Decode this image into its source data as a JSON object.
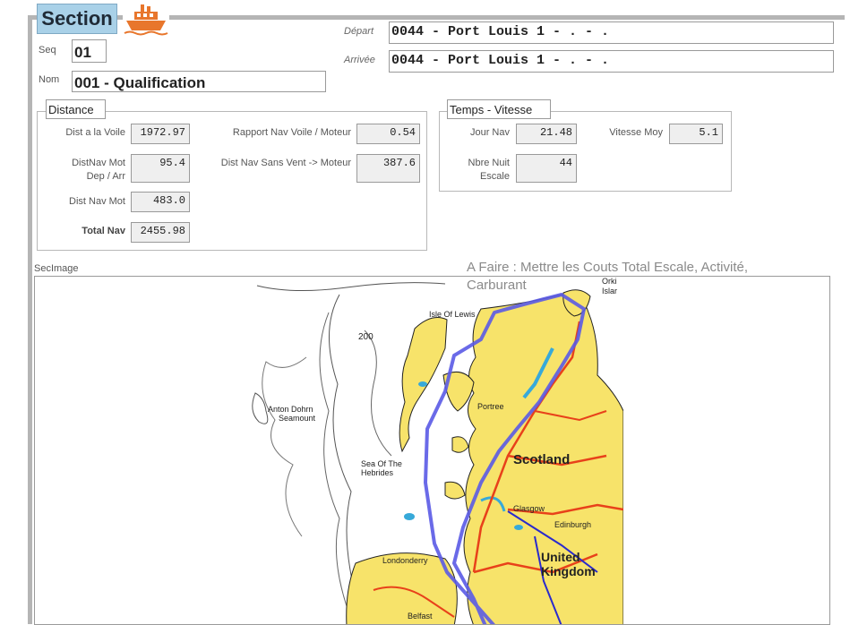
{
  "header": {
    "section_label": "Section",
    "ship_icon": "ship-icon"
  },
  "fields": {
    "seq_label": "Seq",
    "seq_value": "01",
    "nom_label": "Nom",
    "nom_value": "001 - Qualification",
    "depart_label": "Départ",
    "depart_value": "0044 - Port Louis 1 - . - .",
    "arrivee_label": "Arrivée",
    "arrivee_value": "0044 - Port Louis 1 - . - ."
  },
  "distance": {
    "tab_label": "Distance",
    "dist_voile_label": "Dist a la Voile",
    "dist_voile_value": "1972.97",
    "rapport_label": "Rapport Nav Voile / Moteur",
    "rapport_value": "0.54",
    "distnav_mot_label_1": "DistNav Mot",
    "distnav_mot_label_2": "Dep / Arr",
    "distnav_mot_value": "95.4",
    "sans_vent_label": "Dist Nav Sans Vent -> Moteur",
    "sans_vent_value": "387.6",
    "dist_nav_mot_label": "Dist Nav Mot",
    "dist_nav_mot_value": "483.0",
    "total_nav_label": "Total Nav",
    "total_nav_value": "2455.98"
  },
  "temps": {
    "tab_label": "Temps - Vitesse",
    "jour_nav_label": "Jour Nav",
    "jour_nav_value": "21.48",
    "vitesse_label": "Vitesse Moy",
    "vitesse_value": "5.1",
    "nuit_label_1": "Nbre Nuit",
    "nuit_label_2": "Escale",
    "nuit_value": "44"
  },
  "image_section": {
    "label": "SecImage",
    "note": "A Faire : Mettre les Couts Total Escale, Activité, Carburant",
    "map_labels": {
      "lewis": "Isle Of Lewis",
      "depth": "200",
      "anton": "Anton Dohrn",
      "seamount": "Seamount",
      "portree": "Portree",
      "scotland": "Scotland",
      "sea_hebrides_1": "Sea Of The",
      "sea_hebrides_2": "Hebrides",
      "glasgow": "Glasgow",
      "edinburgh": "Edinburgh",
      "londonderry": "Londonderry",
      "united": "United",
      "kingdom": "Kingdom",
      "belfast": "Belfast",
      "orkney_1": "Orki",
      "orkney_2": "Islar"
    }
  },
  "colors": {
    "section_bg": "#a9d1e8",
    "land": "#f7e36a",
    "route": "#5a5ae6",
    "roads": "#e8411a",
    "water": "#37a9d9"
  }
}
